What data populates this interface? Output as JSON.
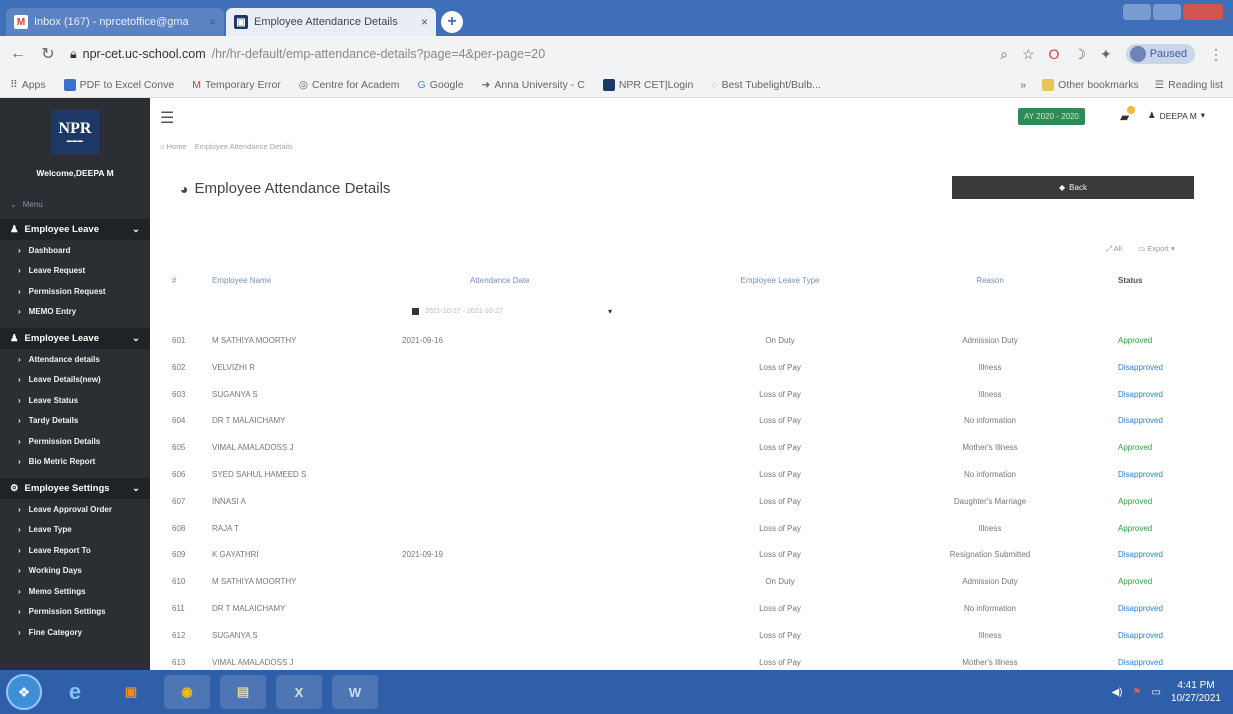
{
  "browser": {
    "tabs": [
      {
        "label": "Inbox (167) - nprcetoffice@gma",
        "active": false
      },
      {
        "label": "Employee Attendance Details",
        "active": true
      }
    ],
    "new_tab": "+",
    "url_host": "npr-cet.uc-school.com",
    "url_path": "/hr/hr-default/emp-attendance-details?page=4&per-page=20",
    "paused_label": "Paused",
    "bookmarks": [
      "Apps",
      "PDF to Excel Conve",
      "Temporary Error",
      "Centre for Academ",
      "Google",
      "Anna University - C",
      "NPR CET|Login",
      "Best Tubelight/Bulb..."
    ],
    "bookmarks_right": [
      "»",
      "Other bookmarks",
      "Reading list"
    ]
  },
  "sidebar": {
    "logo_text": "NPR",
    "welcome": "Welcome,DEEPA M",
    "menu_label": "Menu",
    "groups": [
      {
        "label": "Employee Leave",
        "items": [
          "Dashboard",
          "Leave Request",
          "Permission Request",
          "MEMO Entry"
        ]
      },
      {
        "label": "Employee Leave",
        "items": [
          "Attendance details",
          "Leave Details(new)",
          "Leave Status",
          "Tardy Details",
          "Permission Details",
          "Bio Metric Report"
        ]
      },
      {
        "label": "Employee Settings",
        "items": [
          "Leave Approval Order",
          "Leave Type",
          "Leave Report To",
          "Working Days",
          "Memo Settings",
          "Permission Settings",
          "Fine Category"
        ]
      }
    ]
  },
  "header": {
    "year": "AY 2020 - 2020",
    "user": "DEEPA M"
  },
  "breadcrumb": {
    "home": "Home",
    "current": "Employee Attendance Details"
  },
  "page_title": "Employee Attendance Details",
  "back_label": "Back",
  "tools": {
    "all": "All",
    "export": "Export"
  },
  "table": {
    "headers": {
      "no": "#",
      "name": "Employee Name",
      "date": "Attendance Date",
      "type": "Employee Leave Type",
      "reason": "Reason",
      "status": "Status"
    },
    "filter_text": "2021-10-27 - 2021-10-27",
    "rows": [
      {
        "no": "601",
        "name": "M SATHIYA MOORTHY",
        "date": "2021-09-16",
        "type": "On Duty",
        "reason": "Admission Duty",
        "status": "Approved"
      },
      {
        "no": "602",
        "name": "VELVIZHI R",
        "date": "",
        "type": "Loss of Pay",
        "reason": "Illness",
        "status": "Disapproved"
      },
      {
        "no": "603",
        "name": "SUGANYA S",
        "date": "",
        "type": "Loss of Pay",
        "reason": "Illness",
        "status": "Disapproved"
      },
      {
        "no": "604",
        "name": "DR T MALAICHAMY",
        "date": "",
        "type": "Loss of Pay",
        "reason": "No information",
        "status": "Disapproved"
      },
      {
        "no": "605",
        "name": "VIMAL AMALADOSS J",
        "date": "",
        "type": "Loss of Pay",
        "reason": "Mother's Illness",
        "status": "Approved"
      },
      {
        "no": "606",
        "name": "SYED SAHUL HAMEED S",
        "date": "",
        "type": "Loss of Pay",
        "reason": "No information",
        "status": "Disapproved"
      },
      {
        "no": "607",
        "name": "INNASI A",
        "date": "",
        "type": "Loss of Pay",
        "reason": "Daughter's Marriage",
        "status": "Approved"
      },
      {
        "no": "608",
        "name": "RAJA T",
        "date": "",
        "type": "Loss of Pay",
        "reason": "Illness",
        "status": "Approved"
      },
      {
        "no": "609",
        "name": "K GAYATHRI",
        "date": "2021-09-19",
        "type": "Loss of Pay",
        "reason": "Resignation Submitted",
        "status": "Disapproved"
      },
      {
        "no": "610",
        "name": "M SATHIYA MOORTHY",
        "date": "",
        "type": "On Duty",
        "reason": "Admission Duty",
        "status": "Approved"
      },
      {
        "no": "611",
        "name": "DR T MALAICHAMY",
        "date": "",
        "type": "Loss of Pay",
        "reason": "No information",
        "status": "Disapproved"
      },
      {
        "no": "612",
        "name": "SUGANYA S",
        "date": "",
        "type": "Loss of Pay",
        "reason": "Illness",
        "status": "Disapproved"
      },
      {
        "no": "613",
        "name": "VIMAL AMALADOSS J",
        "date": "",
        "type": "Loss of Pay",
        "reason": "Mother's Illness",
        "status": "Disapproved"
      }
    ]
  },
  "colors": {
    "approved": "#2f9e44",
    "disapproved": "#2d7fd6",
    "sidebar": "#2b2f33",
    "accent": "#2e8b57"
  },
  "taskbar": {
    "apps": [
      "chrome-icon",
      "explorer-icon",
      "excel-icon",
      "word-icon"
    ],
    "time": "4:41 PM",
    "date": "10/27/2021"
  }
}
